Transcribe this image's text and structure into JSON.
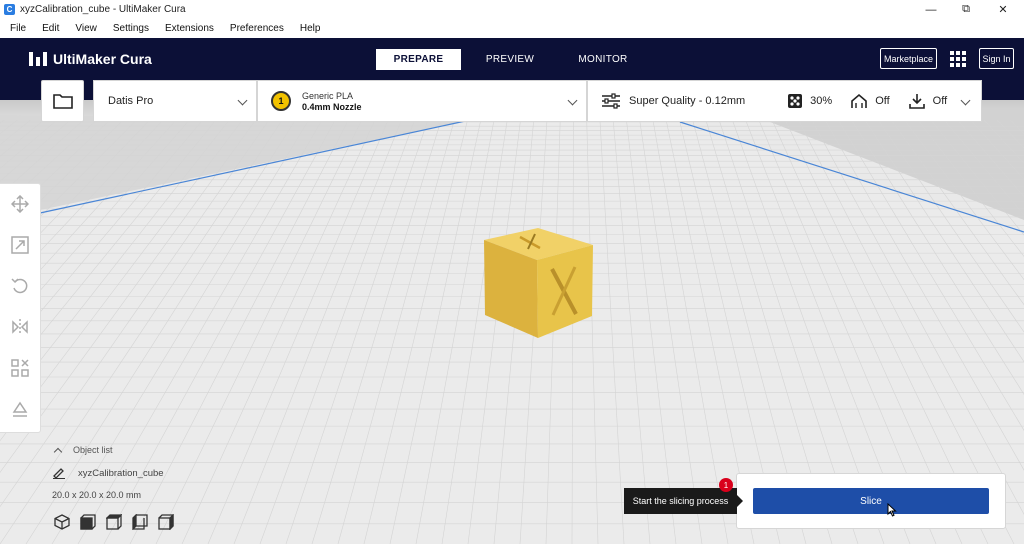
{
  "window": {
    "title": "xyzCalibration_cube - UltiMaker Cura",
    "controls": [
      "minimize-icon",
      "restore-icon",
      "close-icon"
    ]
  },
  "menubar": {
    "items": [
      "File",
      "Edit",
      "View",
      "Settings",
      "Extensions",
      "Preferences",
      "Help"
    ]
  },
  "header": {
    "brand": "UltiMaker Cura",
    "tabs": [
      {
        "label": "PREPARE",
        "active": true
      },
      {
        "label": "PREVIEW",
        "active": false
      },
      {
        "label": "MONITOR",
        "active": false
      }
    ],
    "marketplace_label": "Marketplace",
    "signin_label": "Sign In"
  },
  "toolbar": {
    "open_icon": "folder-icon",
    "printer": "Datis Pro",
    "extruder_number": "1",
    "material": "Generic PLA",
    "nozzle": "0.4mm Nozzle",
    "quality": "Super Quality - 0.12mm",
    "infill": "30%",
    "support": "Off",
    "adhesion": "Off"
  },
  "lefttools": [
    "move-icon",
    "scale-icon",
    "rotate-icon",
    "mirror-icon",
    "per-model-settings-icon",
    "support-blocker-icon"
  ],
  "object_list": {
    "header": "Object list",
    "object_name": "xyzCalibration_cube",
    "dimensions": "20.0 x 20.0 x 20.0 mm",
    "view_icons": [
      "3d-view-icon",
      "front-view-icon",
      "top-view-icon",
      "left-view-icon",
      "right-view-icon"
    ]
  },
  "model": {
    "letters": [
      "Z",
      "X"
    ],
    "color": "#e8c44a"
  },
  "slice": {
    "tooltip": "Start the slicing process",
    "button_label": "Slice",
    "notification_count": "1"
  },
  "colors": {
    "header_bg": "#0c1037",
    "accent_blue": "#1e4ea8",
    "build_plate": "#e9e9e9",
    "notification": "#d9001b"
  }
}
